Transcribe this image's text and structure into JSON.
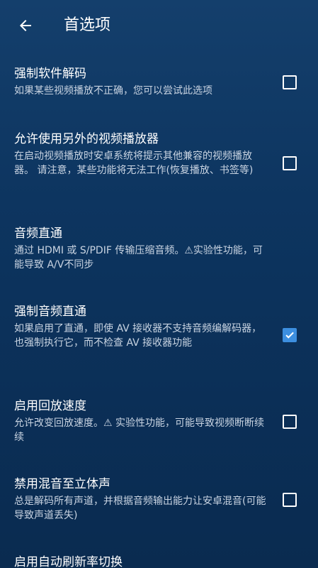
{
  "header": {
    "title": "首选项",
    "back_icon": "arrow-left-icon"
  },
  "preferences": [
    {
      "title": "强制软件解码",
      "summary": "如果某些视频播放不正确，您可以尝试此选项",
      "checked": false
    },
    {
      "title": "允许使用另外的视频播放器",
      "summary": "在启动视频播放时安卓系统将提示其他兼容的视频播放器。 请注意，某些功能将无法工作(恢复播放、书签等)",
      "checked": false
    },
    {
      "title": "音频直通",
      "summary": "通过 HDMI 或 S/PDIF 传输压缩音频。⚠实验性功能，可能导致 A/V不同步",
      "checked": null
    },
    {
      "title": "强制音频直通",
      "summary": "如果启用了直通，即使 AV 接收器不支持音频编解码器，也强制执行它，而不检查 AV 接收器功能",
      "checked": true
    },
    {
      "title": "启用回放速度",
      "summary": "允许改变回放速度。⚠ 实验性功能，可能导致视频断断续续",
      "checked": false
    },
    {
      "title": "禁用混音至立体声",
      "summary": "总是解码所有声道，并根据音频输出能力让安卓混音(可能导致声道丢失)",
      "checked": false
    },
    {
      "title": "启用自动刷新率切换",
      "summary": "",
      "checked": null
    }
  ],
  "colors": {
    "accent": "#3d8fe0",
    "background_top": "#143f6c",
    "background_bottom": "#0a2b50"
  }
}
